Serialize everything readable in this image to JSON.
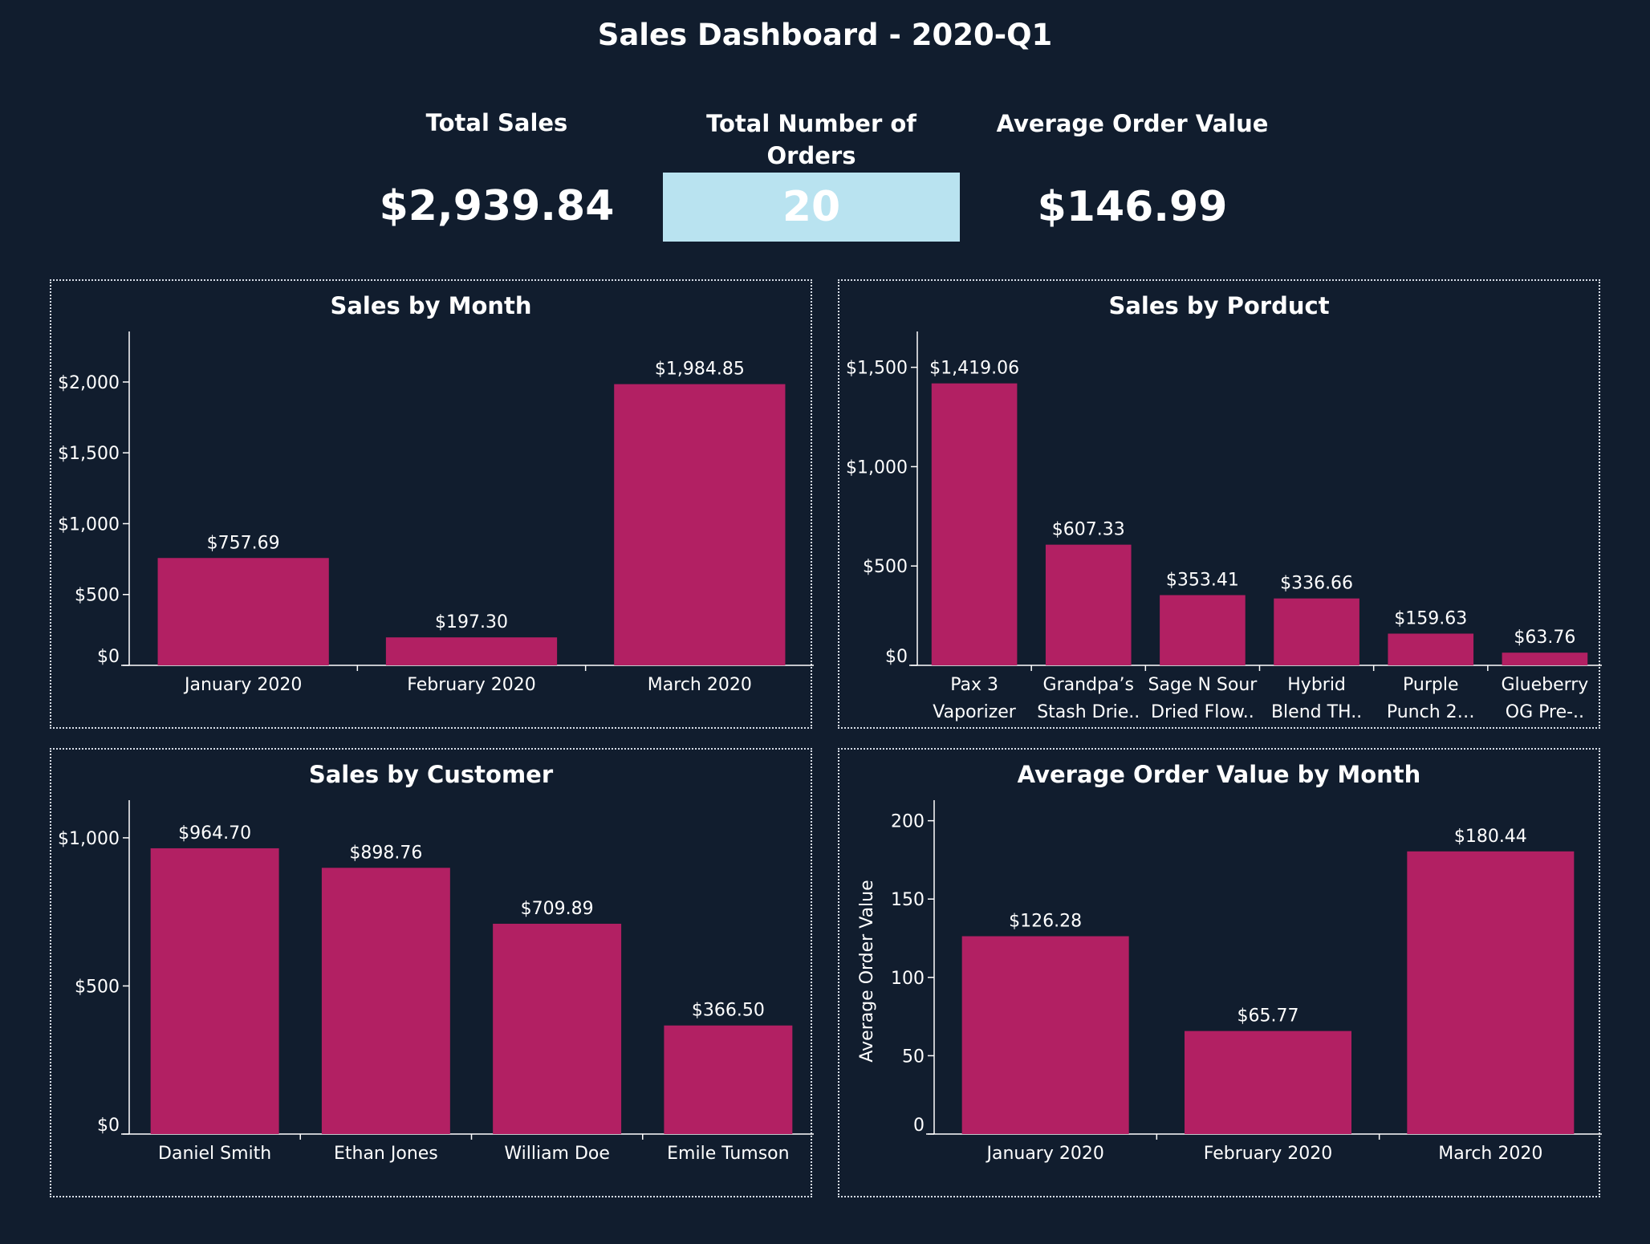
{
  "title": "Sales Dashboard - 2020-Q1",
  "kpis": {
    "total_sales": {
      "label": "Total Sales",
      "value": "$2,939.84"
    },
    "total_orders": {
      "label": "Total Number of Orders",
      "value": "20"
    },
    "avg_order": {
      "label": "Average Order Value",
      "value": "$146.99"
    }
  },
  "colors": {
    "background": "#111d2e",
    "bar": "#b22063",
    "highlight": "#b9e3f0",
    "axis": "#ffffff"
  },
  "chart_data": [
    {
      "type": "bar",
      "title": "Sales by Month",
      "categories": [
        [
          "January 2020"
        ],
        [
          "February 2020"
        ],
        [
          "March 2020"
        ]
      ],
      "values": [
        757.69,
        197.3,
        1984.85
      ],
      "value_labels": [
        "$757.69",
        "$197.30",
        "$1,984.85"
      ],
      "yticks": [
        0,
        500,
        1000,
        1500,
        2000
      ],
      "ytick_labels": [
        "$0",
        "$500",
        "$1,000",
        "$1,500",
        "$2,000"
      ],
      "ylim": [
        0,
        2300
      ],
      "ylabel": ""
    },
    {
      "type": "bar",
      "title": "Sales by Porduct",
      "categories": [
        [
          "Pax 3",
          "Vaporizer"
        ],
        [
          "Grandpa’s",
          "Stash Drie.."
        ],
        [
          "Sage N Sour",
          "Dried Flow.."
        ],
        [
          "Hybrid",
          "Blend TH.."
        ],
        [
          "Purple",
          "Punch 2…"
        ],
        [
          "Glueberry",
          "OG Pre-.."
        ]
      ],
      "values": [
        1419.06,
        607.33,
        353.41,
        336.66,
        159.63,
        63.76
      ],
      "value_labels": [
        "$1,419.06",
        "$607.33",
        "$353.41",
        "$336.66",
        "$159.63",
        "$63.76"
      ],
      "yticks": [
        0,
        500,
        1000,
        1500
      ],
      "ytick_labels": [
        "$0",
        "$500",
        "$1,000",
        "$1,500"
      ],
      "ylim": [
        0,
        1640
      ],
      "ylabel": ""
    },
    {
      "type": "bar",
      "title": "Sales by Customer",
      "categories": [
        [
          "Daniel Smith"
        ],
        [
          "Ethan Jones"
        ],
        [
          "William Doe"
        ],
        [
          "Emile Tumson"
        ]
      ],
      "values": [
        964.7,
        898.76,
        709.89,
        366.5
      ],
      "value_labels": [
        "$964.70",
        "$898.76",
        "$709.89",
        "$366.50"
      ],
      "yticks": [
        0,
        500,
        1000
      ],
      "ytick_labels": [
        "$0",
        "$500",
        "$1,000"
      ],
      "ylim": [
        0,
        1100
      ],
      "ylabel": ""
    },
    {
      "type": "bar",
      "title": "Average Order Value by Month",
      "categories": [
        [
          "January 2020"
        ],
        [
          "February 2020"
        ],
        [
          "March 2020"
        ]
      ],
      "values": [
        126.28,
        65.77,
        180.44
      ],
      "value_labels": [
        "$126.28",
        "$65.77",
        "$180.44"
      ],
      "yticks": [
        0,
        50,
        100,
        150,
        200
      ],
      "ytick_labels": [
        "0",
        "50",
        "100",
        "150",
        "200"
      ],
      "ylim": [
        0,
        208
      ],
      "ylabel": "Average Order Value"
    }
  ]
}
